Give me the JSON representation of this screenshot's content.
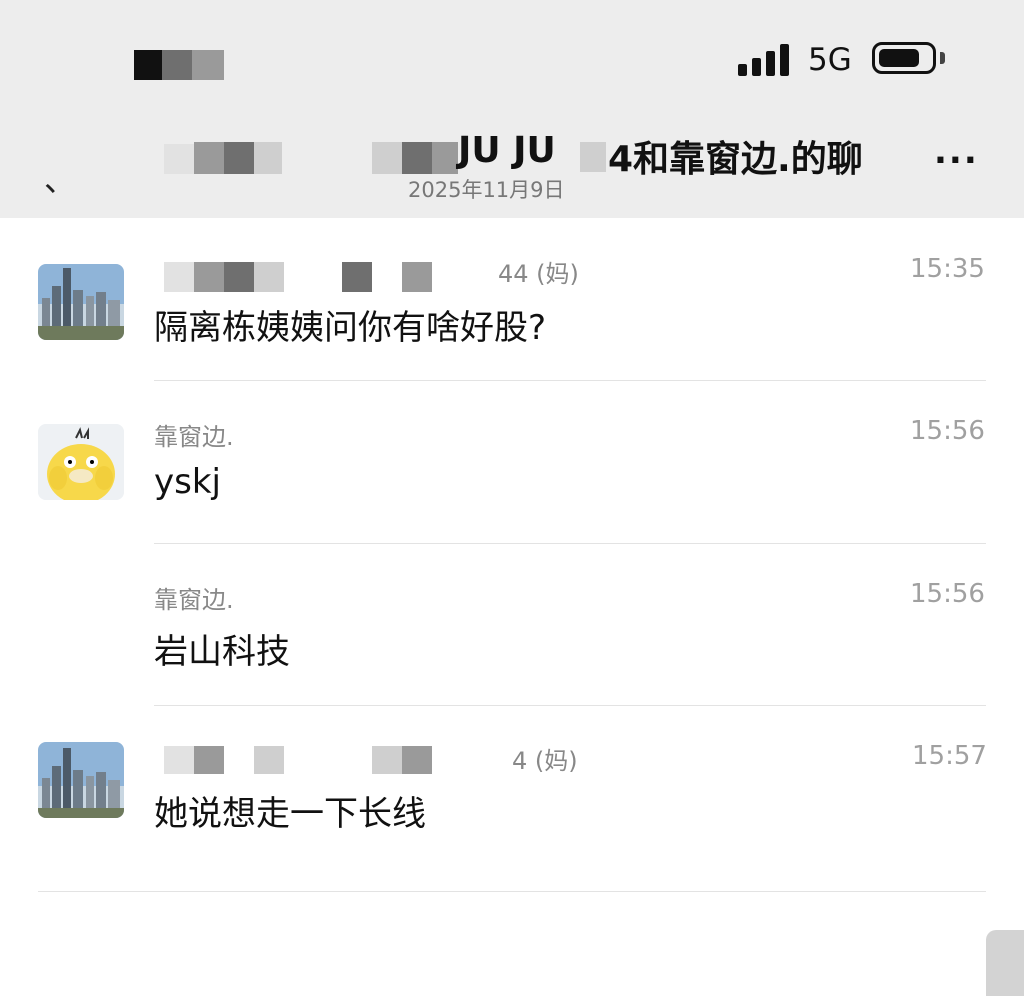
{
  "status": {
    "network": "5G"
  },
  "header": {
    "title_fragment": "JU JU",
    "title": "4和靠窗边.的聊",
    "date": "2025年11月9日",
    "back_icon": "chevron-left-icon",
    "more_icon": "more-icon",
    "more_label": "..."
  },
  "messages": [
    {
      "sender_suffix": "44 (妈)",
      "time": "15:35",
      "text": "隔离栋姨姨问你有啥好股?",
      "avatar": "city-skyline"
    },
    {
      "sender": "靠窗边.",
      "time": "15:56",
      "text": "yskj",
      "avatar": "yellow-duck"
    },
    {
      "sender": "靠窗边.",
      "time": "15:56",
      "text": "岩山科技"
    },
    {
      "sender_suffix": "4 (妈)",
      "time": "15:57",
      "text": "她说想走一下长线",
      "avatar": "city-skyline"
    }
  ],
  "colors": {
    "header_bg": "#ededed",
    "time": "#a0a0a0",
    "sender": "#888888"
  }
}
